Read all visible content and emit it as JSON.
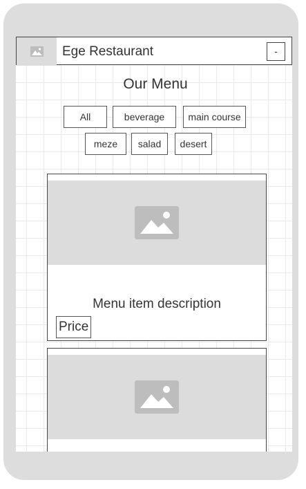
{
  "colors": {
    "frame": "#dddddd",
    "placeholder": "#dcdcdc",
    "placeholder_icon": "#bdbdbd",
    "border": "#444444",
    "text": "#333333"
  },
  "navbar": {
    "brand": "Ege Restaurant",
    "logo_icon": "image-placeholder-icon",
    "menu_button_label": "-"
  },
  "page_title": "Our Menu",
  "filters": [
    "All",
    "beverage",
    "main course",
    "meze",
    "salad",
    "desert"
  ],
  "cards": [
    {
      "image_icon": "image-placeholder-icon",
      "description": "Menu item description",
      "price": "Price"
    },
    {
      "image_icon": "image-placeholder-icon"
    }
  ]
}
